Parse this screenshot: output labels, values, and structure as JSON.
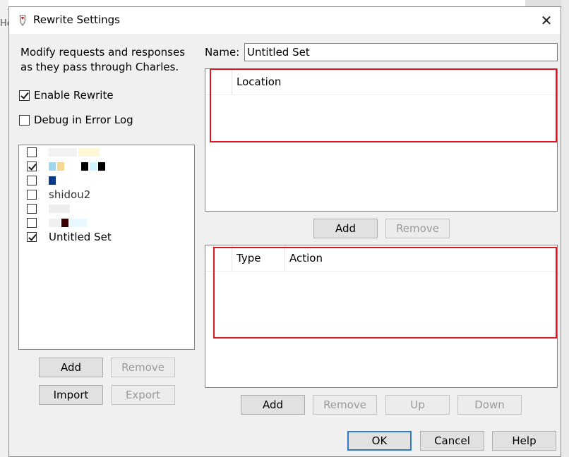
{
  "background": {
    "peek_text": "He"
  },
  "dialog": {
    "title": "Rewrite Settings",
    "close_glyph": "✕",
    "description": "Modify requests and responses as they pass through Charles.",
    "enable_rewrite": {
      "label": "Enable Rewrite",
      "checked": true
    },
    "debug_error_log": {
      "label": "Debug in Error Log",
      "checked": false
    },
    "sets": [
      {
        "label": "",
        "checked": false
      },
      {
        "label": "",
        "checked": true
      },
      {
        "label": "",
        "checked": false
      },
      {
        "label": "shidou2",
        "checked": false
      },
      {
        "label": "",
        "checked": false
      },
      {
        "label": "",
        "checked": false
      },
      {
        "label": "Untitled Set",
        "checked": true
      }
    ],
    "sets_buttons": {
      "add": "Add",
      "remove": "Remove",
      "import": "Import",
      "export": "Export"
    },
    "name_label": "Name:",
    "name_value": "Untitled Set",
    "location_table": {
      "header": "Location",
      "add": "Add",
      "remove": "Remove"
    },
    "rules_table": {
      "header_type": "Type",
      "header_action": "Action",
      "add": "Add",
      "remove": "Remove",
      "up": "Up",
      "down": "Down"
    },
    "footer": {
      "ok": "OK",
      "cancel": "Cancel",
      "help": "Help"
    }
  },
  "colors": {
    "highlight_box": "#e0141e",
    "default_button_border": "#2f7ad0"
  }
}
